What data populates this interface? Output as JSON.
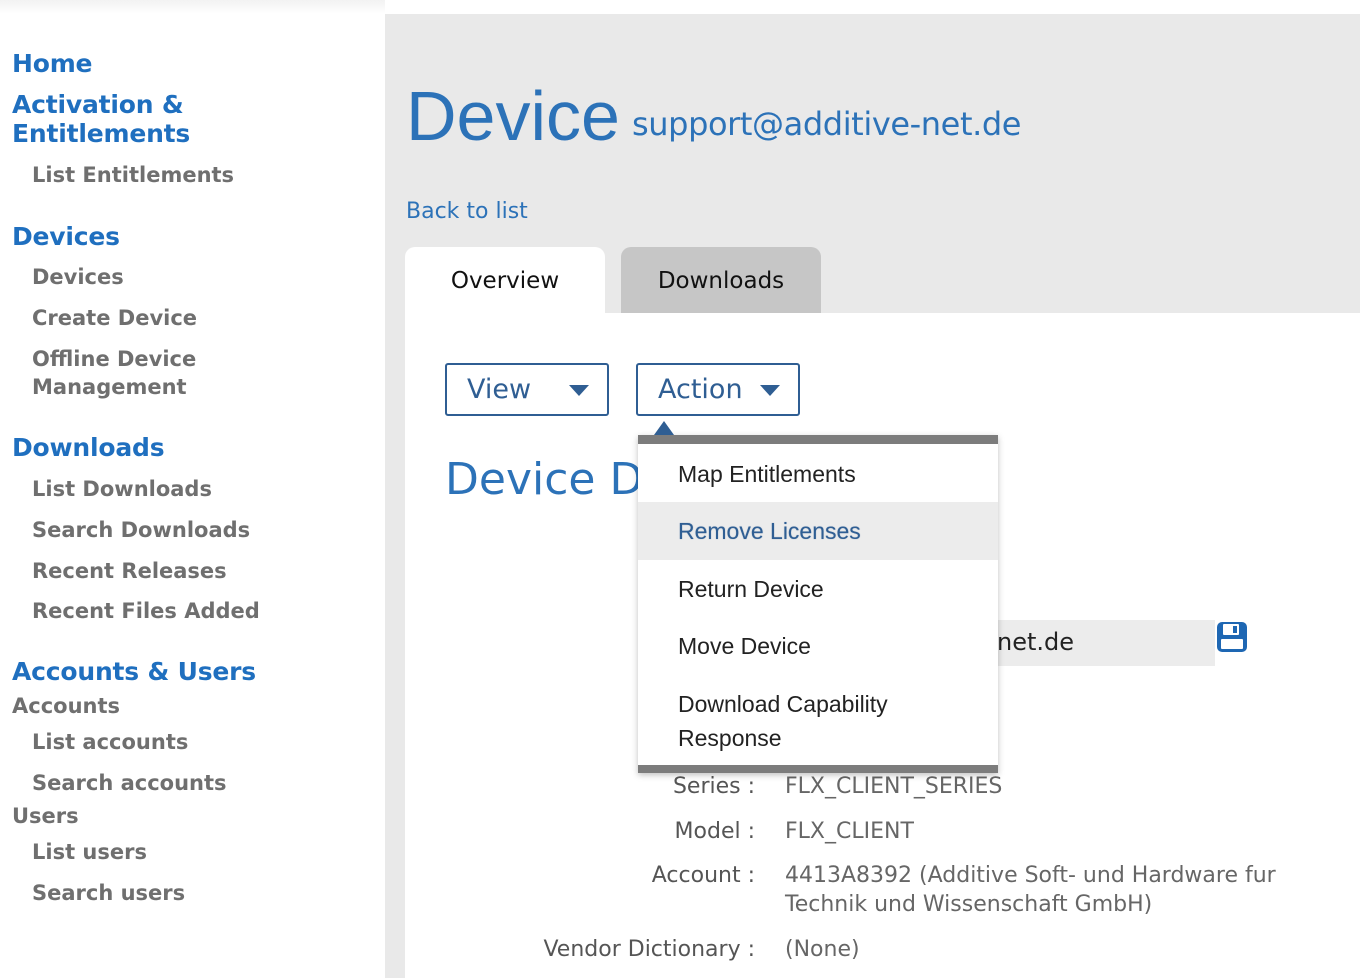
{
  "sidebar": {
    "home": "Home",
    "activation": "Activation & Entitlements",
    "list_entitlements": "List Entitlements",
    "devices_heading": "Devices",
    "devices": "Devices",
    "create_device": "Create Device",
    "offline_device_management": "Offline Device Management",
    "downloads_heading": "Downloads",
    "list_downloads": "List Downloads",
    "search_downloads": "Search Downloads",
    "recent_releases": "Recent Releases",
    "recent_files_added": "Recent Files Added",
    "accounts_users_heading": "Accounts & Users",
    "accounts_sub": "Accounts",
    "list_accounts": "List accounts",
    "search_accounts": "Search accounts",
    "users_sub": "Users",
    "list_users": "List users",
    "search_users": "Search users"
  },
  "header": {
    "title": "Device",
    "user_email": "support@additive-net.de",
    "back_link": "Back to list"
  },
  "tabs": {
    "overview": "Overview",
    "downloads": "Downloads",
    "active": "Overview"
  },
  "toolbar": {
    "view_label": "View",
    "action_label": "Action"
  },
  "action_menu": {
    "items": [
      "Map Entitlements",
      "Remove Licenses",
      "Return Device",
      "Move Device",
      "Download Capability Response"
    ],
    "highlighted": "Remove Licenses"
  },
  "details": {
    "section_title": "Device De",
    "email_visible": "net.de",
    "series_label": "Series :",
    "series_value": "FLX_CLIENT_SERIES",
    "model_label": "Model :",
    "model_value": "FLX_CLIENT",
    "account_label": "Account :",
    "account_value": "4413A8392 (Additive Soft- und Hardware fur Technik und Wissenschaft GmbH)",
    "vendor_dictionary_label": "Vendor Dictionary :",
    "vendor_dictionary_value": "(None)"
  },
  "colors": {
    "brand_blue": "#2c72b8",
    "nav_blue": "#1f6fbf",
    "button_blue": "#2f5e93",
    "panel_gray": "#e9e9e9"
  },
  "icons": {
    "save": "floppy-disk-icon",
    "caret": "caret-down-icon"
  }
}
